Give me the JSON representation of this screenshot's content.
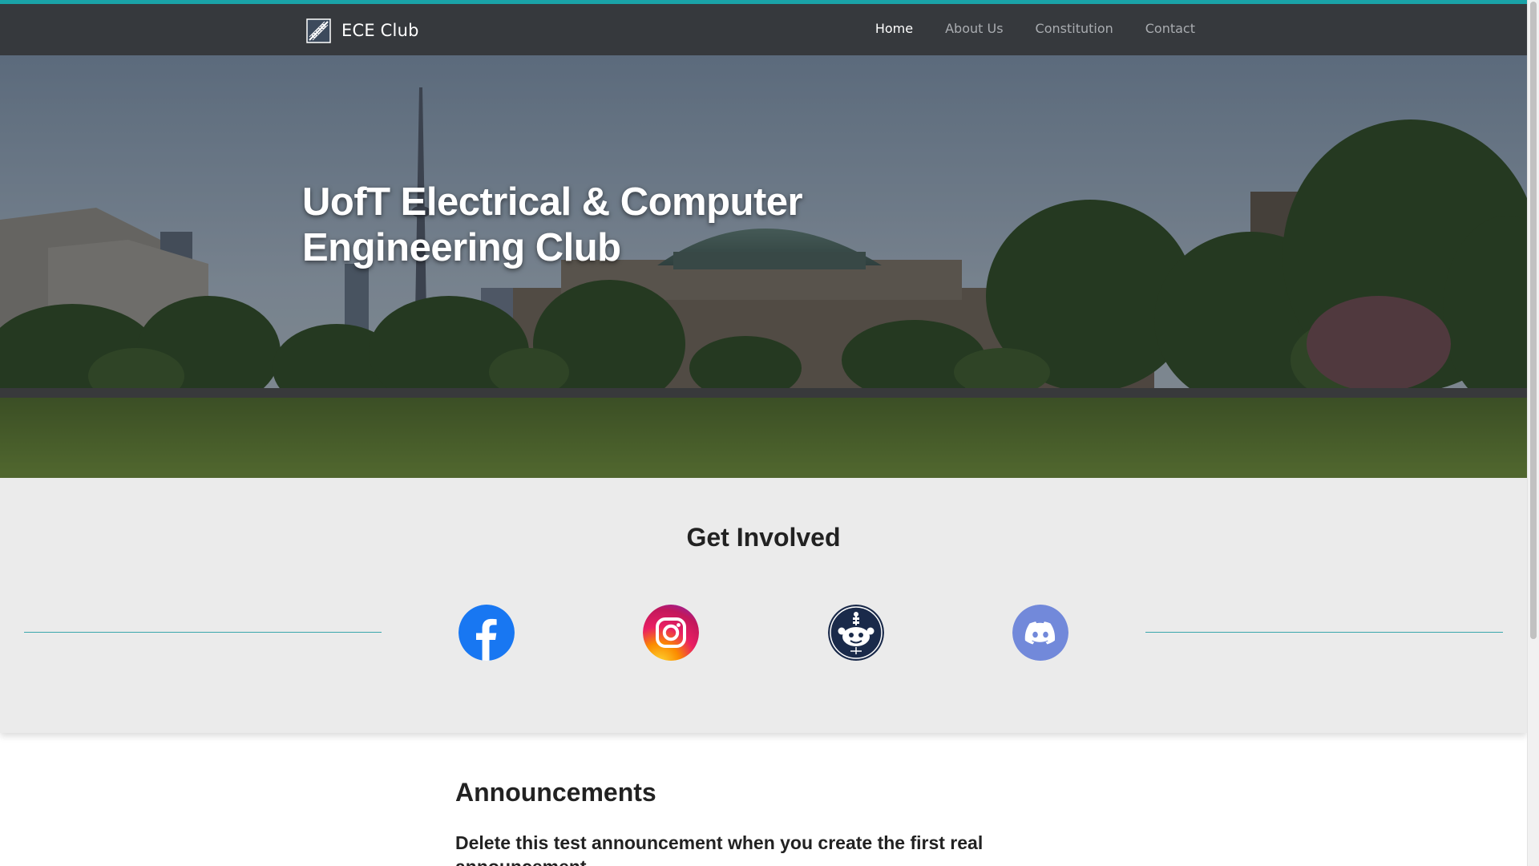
{
  "navbar": {
    "brand": "ECE Club",
    "links": [
      {
        "label": "Home",
        "active": true
      },
      {
        "label": "About Us",
        "active": false
      },
      {
        "label": "Constitution",
        "active": false
      },
      {
        "label": "Contact",
        "active": false
      }
    ]
  },
  "hero": {
    "title": "UofT Electrical & Computer Engineering Club"
  },
  "involved": {
    "title": "Get Involved",
    "socials": [
      {
        "icon": "facebook-icon"
      },
      {
        "icon": "instagram-icon"
      },
      {
        "icon": "reddit-icon"
      },
      {
        "icon": "discord-icon"
      }
    ]
  },
  "announcements": {
    "title": "Announcements",
    "items": [
      {
        "title": "Delete this test announcement when you create the first real announcement"
      }
    ]
  },
  "colors": {
    "accent": "#1aa3a8",
    "navbar": "#36393d",
    "section_bg": "#ebebeb"
  }
}
